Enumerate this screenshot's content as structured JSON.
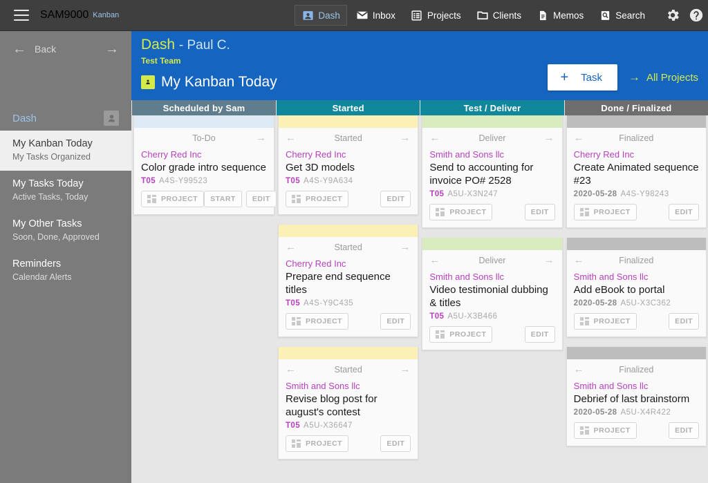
{
  "topbar": {
    "menu_icon": "hamburger-icon",
    "brand": "SAM9000",
    "brand_sub": "Kanban",
    "nav": [
      {
        "label": "Dash",
        "icon": "user-card-icon",
        "active": true
      },
      {
        "label": "Inbox",
        "icon": "envelope-icon",
        "active": false
      },
      {
        "label": "Projects",
        "icon": "list-box-icon",
        "active": false
      },
      {
        "label": "Clients",
        "icon": "folder-icon",
        "active": false
      },
      {
        "label": "Memos",
        "icon": "document-icon",
        "active": false
      },
      {
        "label": "Search",
        "icon": "magnifier-doc-icon",
        "active": false
      }
    ],
    "settings_icon": "gear-icon",
    "help_icon": "question-circle-icon"
  },
  "sidebar": {
    "back_label": "Back",
    "back_icon": "arrow-left-icon",
    "forward_icon": "arrow-right-icon",
    "section_label": "Dash",
    "avatar_icon": "user-icon",
    "items": [
      {
        "title": "My Kanban Today",
        "sub": "My Tasks Organized",
        "selected": true
      },
      {
        "title": "My Tasks Today",
        "sub": "Active Tasks, Today",
        "selected": false
      },
      {
        "title": "My Other Tasks",
        "sub": "Soon, Done, Approved",
        "selected": false
      },
      {
        "title": "Reminders",
        "sub": "Calendar Alerts",
        "selected": false
      }
    ]
  },
  "header": {
    "title": "Dash",
    "title_suffix": "- Paul C.",
    "team": "Test Team",
    "badge_icon": "user-card-icon",
    "page_title": "My Kanban Today",
    "task_button": "Task",
    "task_button_icon": "plus-icon",
    "all_projects": "All Projects",
    "all_projects_icon": "arrow-right-icon",
    "accent_blue": "#1565c0",
    "accent_lime": "#d4e94a"
  },
  "board": {
    "columns": [
      {
        "name": "Scheduled by Sam",
        "head_color": "#5f7d8c",
        "strip_color": "#dceaf6",
        "cards": [
          {
            "stage": "To-Do",
            "left_arrow": false,
            "right_arrow": true,
            "client": "Cherry Red Inc",
            "title": "Color grade intro sequence",
            "code": "T05",
            "date": "",
            "id": "A4S-Y99523",
            "project_label": "PROJECT",
            "start_label": "START",
            "edit_label": "EDIT"
          }
        ]
      },
      {
        "name": "Started",
        "head_color": "#11879b",
        "strip_color": "#fbf1b7",
        "cards": [
          {
            "stage": "Started",
            "left_arrow": true,
            "right_arrow": true,
            "client": "Cherry Red Inc",
            "title": "Get 3D models",
            "code": "T05",
            "date": "",
            "id": "A4S-Y9A634",
            "project_label": "PROJECT",
            "start_label": "",
            "edit_label": "EDIT"
          },
          {
            "stage": "Started",
            "left_arrow": true,
            "right_arrow": true,
            "client": "Cherry Red Inc",
            "title": "Prepare end sequence titles",
            "code": "T05",
            "date": "",
            "id": "A4S-Y9C435",
            "project_label": "PROJECT",
            "start_label": "",
            "edit_label": "EDIT"
          },
          {
            "stage": "Started",
            "left_arrow": true,
            "right_arrow": true,
            "client": "Smith and Sons llc",
            "title": "Revise blog post for august's contest",
            "code": "T05",
            "date": "",
            "id": "A5U-X36647",
            "project_label": "PROJECT",
            "start_label": "",
            "edit_label": "EDIT"
          }
        ]
      },
      {
        "name": "Test / Deliver",
        "head_color": "#11879b",
        "strip_color": "#d9ecc0",
        "cards": [
          {
            "stage": "Deliver",
            "left_arrow": true,
            "right_arrow": true,
            "client": "Smith and Sons llc",
            "title": "Send to accounting for invoice PO# 2528",
            "code": "T05",
            "date": "",
            "id": "A5U-X3N247",
            "project_label": "PROJECT",
            "start_label": "",
            "edit_label": "EDIT"
          },
          {
            "stage": "Deliver",
            "left_arrow": true,
            "right_arrow": true,
            "client": "Smith and Sons llc",
            "title": "Video testimonial dubbing & titles",
            "code": "T05",
            "date": "",
            "id": "A5U-X3B466",
            "project_label": "PROJECT",
            "start_label": "",
            "edit_label": "EDIT"
          }
        ]
      },
      {
        "name": "Done / Finalized",
        "head_color": "#6e6e6e",
        "strip_color": "#bdbdbd",
        "cards": [
          {
            "stage": "Finalized",
            "left_arrow": true,
            "right_arrow": false,
            "client": "Cherry Red Inc",
            "title": "Create Animated sequence #23",
            "code": "",
            "date": "2020-05-28",
            "id": "A4S-Y98243",
            "project_label": "PROJECT",
            "start_label": "",
            "edit_label": "EDIT"
          },
          {
            "stage": "Finalized",
            "left_arrow": true,
            "right_arrow": false,
            "client": "Smith and Sons llc",
            "title": "Add eBook to portal",
            "code": "",
            "date": "2020-05-28",
            "id": "A5U-X3C362",
            "project_label": "PROJECT",
            "start_label": "",
            "edit_label": "EDIT"
          },
          {
            "stage": "Finalized",
            "left_arrow": true,
            "right_arrow": false,
            "client": "Smith and Sons llc",
            "title": "Debrief of last brainstorm",
            "code": "",
            "date": "2020-05-28",
            "id": "A5U-X4R422",
            "project_label": "PROJECT",
            "start_label": "",
            "edit_label": "EDIT"
          }
        ]
      }
    ]
  }
}
